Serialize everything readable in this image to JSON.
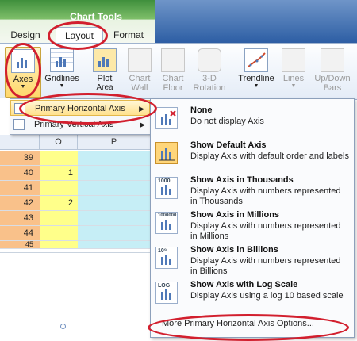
{
  "ribbon": {
    "context_title": "Chart Tools",
    "tabs": {
      "design": "Design",
      "layout": "Layout",
      "format": "Format"
    },
    "buttons": {
      "axes": "Axes",
      "gridlines": "Gridlines",
      "plot_area_1": "Plot",
      "plot_area_2": "Area",
      "chart_wall_1": "Chart",
      "chart_wall_2": "Wall",
      "chart_floor_1": "Chart",
      "chart_floor_2": "Floor",
      "rotation_1": "3-D",
      "rotation_2": "Rotation",
      "trendline": "Trendline",
      "lines": "Lines",
      "updown_1": "Up/Down",
      "updown_2": "Bars"
    }
  },
  "submenu": {
    "items": [
      {
        "label": "Primary Horizontal Axis",
        "arrow": "▶"
      },
      {
        "label": "Primary Vertical Axis",
        "arrow": "▶"
      }
    ]
  },
  "sheet": {
    "columns": [
      "O",
      "P"
    ],
    "rows": [
      {
        "num": "39",
        "o": ""
      },
      {
        "num": "40",
        "o": "1"
      },
      {
        "num": "41",
        "o": ""
      },
      {
        "num": "42",
        "o": "2"
      },
      {
        "num": "43",
        "o": ""
      },
      {
        "num": "44",
        "o": ""
      },
      {
        "num": "45",
        "o": ""
      }
    ]
  },
  "options": [
    {
      "title": "None",
      "desc": "Do not display Axis",
      "badge": ""
    },
    {
      "title": "Show Default Axis",
      "desc": "Display Axis with default order and labels",
      "badge": ""
    },
    {
      "title": "Show Axis in Thousands",
      "desc": "Display Axis with numbers represented in Thousands",
      "badge": "1000"
    },
    {
      "title": "Show Axis in Millions",
      "desc": "Display Axis with numbers represented in Millions",
      "badge": "1000000"
    },
    {
      "title": "Show Axis in Billions",
      "desc": "Display Axis with numbers represented in Billions",
      "badge": "10⁹"
    },
    {
      "title": "Show Axis with Log Scale",
      "desc": "Display Axis using a log 10 based scale",
      "badge": "LOG"
    }
  ],
  "more_options": "More Primary Horizontal Axis Options...",
  "colors": {
    "highlight_circle": "#d21f2e",
    "ribbon_green": "#3f8f3c",
    "ribbon_blue": "#2d5ea4"
  }
}
